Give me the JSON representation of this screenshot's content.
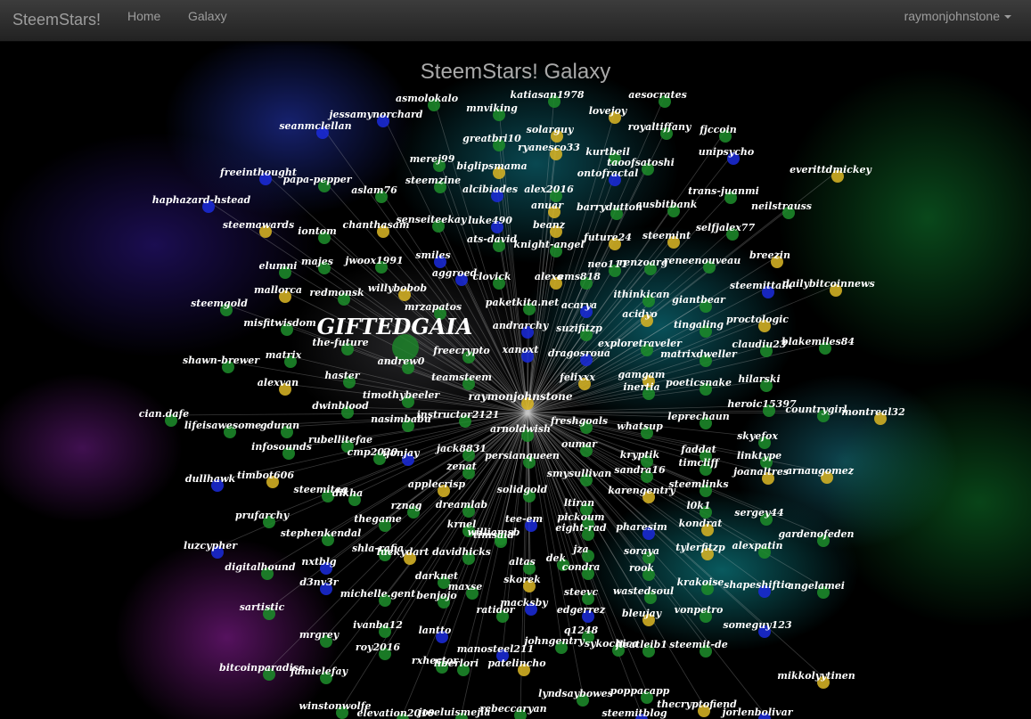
{
  "navbar": {
    "brand": "SteemStars!",
    "links": [
      "Home",
      "Galaxy"
    ],
    "user": "raymonjohnstone"
  },
  "galaxy": {
    "title": "SteemStars! Galaxy",
    "center_user": "raymonjohnstone",
    "featured_label": "GIFTEDGAIA",
    "colors": {
      "green": "#1d8a2a",
      "yellow": "#d6b324",
      "blue": "#1a2ad6",
      "link": "#c8c8c8",
      "label": "#ffffff"
    },
    "nodes": [
      {
        "name": "asmolokalo",
        "color": "green"
      },
      {
        "name": "katiasan1978",
        "color": "green"
      },
      {
        "name": "aesocrates",
        "color": "green"
      },
      {
        "name": "jessamynorchard",
        "color": "blue"
      },
      {
        "name": "mnviking",
        "color": "green"
      },
      {
        "name": "lovejoy",
        "color": "yellow"
      },
      {
        "name": "seanmclellan",
        "color": "blue"
      },
      {
        "name": "royaltiffany",
        "color": "green"
      },
      {
        "name": "fjccoin",
        "color": "green"
      },
      {
        "name": "greatbri10",
        "color": "green"
      },
      {
        "name": "solarguy",
        "color": "yellow"
      },
      {
        "name": "ryanesco33",
        "color": "yellow"
      },
      {
        "name": "kurtbeil",
        "color": "green"
      },
      {
        "name": "unipsycho",
        "color": "blue"
      },
      {
        "name": "merej99",
        "color": "green"
      },
      {
        "name": "taoofsatoshi",
        "color": "green"
      },
      {
        "name": "biglipsmama",
        "color": "yellow"
      },
      {
        "name": "freeinthought",
        "color": "blue"
      },
      {
        "name": "ontofractal",
        "color": "blue"
      },
      {
        "name": "everittdmickey",
        "color": "yellow"
      },
      {
        "name": "papa-pepper",
        "color": "green"
      },
      {
        "name": "steemzine",
        "color": "green"
      },
      {
        "name": "aslam76",
        "color": "green"
      },
      {
        "name": "alcibiades",
        "color": "blue"
      },
      {
        "name": "alex2016",
        "color": "green"
      },
      {
        "name": "trans-juanmi",
        "color": "green"
      },
      {
        "name": "haphazard-hstead",
        "color": "blue"
      },
      {
        "name": "anuar",
        "color": "yellow"
      },
      {
        "name": "barrydutton",
        "color": "green"
      },
      {
        "name": "ausbitbank",
        "color": "green"
      },
      {
        "name": "neilstrauss",
        "color": "green"
      },
      {
        "name": "senseiteekay",
        "color": "green"
      },
      {
        "name": "luke490",
        "color": "blue"
      },
      {
        "name": "steemawards",
        "color": "yellow"
      },
      {
        "name": "chanthasam",
        "color": "yellow"
      },
      {
        "name": "beanz",
        "color": "yellow"
      },
      {
        "name": "iontom",
        "color": "green"
      },
      {
        "name": "ats-david",
        "color": "green"
      },
      {
        "name": "selfjalex77",
        "color": "green"
      },
      {
        "name": "knight-angel",
        "color": "green"
      },
      {
        "name": "future24",
        "color": "yellow"
      },
      {
        "name": "steemint",
        "color": "yellow"
      },
      {
        "name": "smiles",
        "color": "blue"
      },
      {
        "name": "breezin",
        "color": "yellow"
      },
      {
        "name": "elumni",
        "color": "green"
      },
      {
        "name": "majes",
        "color": "green"
      },
      {
        "name": "jwoox1991",
        "color": "green"
      },
      {
        "name": "renzoarg",
        "color": "green"
      },
      {
        "name": "reneenouveau",
        "color": "green"
      },
      {
        "name": "neo111",
        "color": "green"
      },
      {
        "name": "aggroed",
        "color": "blue"
      },
      {
        "name": "clovick",
        "color": "green"
      },
      {
        "name": "alexo",
        "color": "yellow"
      },
      {
        "name": "ems818",
        "color": "green"
      },
      {
        "name": "mallorca",
        "color": "yellow"
      },
      {
        "name": "willybobob",
        "color": "yellow"
      },
      {
        "name": "steemittalk",
        "color": "blue"
      },
      {
        "name": "dailybitcoinnews",
        "color": "yellow"
      },
      {
        "name": "redmonsk",
        "color": "green"
      },
      {
        "name": "ithinkican",
        "color": "green"
      },
      {
        "name": "steemgold",
        "color": "green"
      },
      {
        "name": "paketkita.net",
        "color": "green"
      },
      {
        "name": "acarya",
        "color": "blue"
      },
      {
        "name": "giantbear",
        "color": "green"
      },
      {
        "name": "mrzapatos",
        "color": "green"
      },
      {
        "name": "acidyo",
        "color": "yellow"
      },
      {
        "name": "misfitwisdom",
        "color": "green"
      },
      {
        "name": "andrarchy",
        "color": "blue"
      },
      {
        "name": "suzifitzp",
        "color": "green"
      },
      {
        "name": "tingaling",
        "color": "green"
      },
      {
        "name": "proctologic",
        "color": "yellow"
      },
      {
        "name": "the-future",
        "color": "green"
      },
      {
        "name": "exploretraveler",
        "color": "green"
      },
      {
        "name": "claudiu23",
        "color": "green"
      },
      {
        "name": "blakemiles84",
        "color": "green"
      },
      {
        "name": "xanoxt",
        "color": "blue"
      },
      {
        "name": "freecrypto",
        "color": "green"
      },
      {
        "name": "matrix",
        "color": "green"
      },
      {
        "name": "dragosroua",
        "color": "blue"
      },
      {
        "name": "matrixdweller",
        "color": "green"
      },
      {
        "name": "andrew0",
        "color": "green"
      },
      {
        "name": "shawn-brewer",
        "color": "green"
      },
      {
        "name": "haster",
        "color": "green"
      },
      {
        "name": "teamsteem",
        "color": "green"
      },
      {
        "name": "felixxx",
        "color": "yellow"
      },
      {
        "name": "gamgam",
        "color": "yellow"
      },
      {
        "name": "hilarski",
        "color": "green"
      },
      {
        "name": "alexvan",
        "color": "yellow"
      },
      {
        "name": "inertia",
        "color": "green"
      },
      {
        "name": "poeticsnake",
        "color": "green"
      },
      {
        "name": "timothybeeler",
        "color": "green"
      },
      {
        "name": "raymonjohnstone",
        "color": "yellow"
      },
      {
        "name": "heroic15397",
        "color": "green"
      },
      {
        "name": "dwinblood",
        "color": "green"
      },
      {
        "name": "countrygirl",
        "color": "green"
      },
      {
        "name": "montreal32",
        "color": "yellow"
      },
      {
        "name": "leprechaun",
        "color": "green"
      },
      {
        "name": "cian.dafe",
        "color": "green"
      },
      {
        "name": "nasimbabu",
        "color": "green"
      },
      {
        "name": "instructor2121",
        "color": "green"
      },
      {
        "name": "freshgoals",
        "color": "green"
      },
      {
        "name": "lifeisawesome",
        "color": "green"
      },
      {
        "name": "gduran",
        "color": "green"
      },
      {
        "name": "arnoldwish",
        "color": "green"
      },
      {
        "name": "whatsup",
        "color": "green"
      },
      {
        "name": "skyefox",
        "color": "green"
      },
      {
        "name": "rubellitefae",
        "color": "green"
      },
      {
        "name": "oumar",
        "color": "green"
      },
      {
        "name": "infosounds",
        "color": "green"
      },
      {
        "name": "kryptik",
        "color": "green"
      },
      {
        "name": "faddat",
        "color": "green"
      },
      {
        "name": "cmp2020",
        "color": "green"
      },
      {
        "name": "ijonjay",
        "color": "blue"
      },
      {
        "name": "jack8831",
        "color": "green"
      },
      {
        "name": "persianqueen",
        "color": "green"
      },
      {
        "name": "linktype",
        "color": "green"
      },
      {
        "name": "timcliff",
        "color": "green"
      },
      {
        "name": "zenat",
        "color": "green"
      },
      {
        "name": "sandra16",
        "color": "green"
      },
      {
        "name": "arnaugomez",
        "color": "yellow"
      },
      {
        "name": "joanaltres",
        "color": "yellow"
      },
      {
        "name": "timbot606",
        "color": "yellow"
      },
      {
        "name": "dullhawk",
        "color": "blue"
      },
      {
        "name": "smysullivan",
        "color": "green"
      },
      {
        "name": "applecrisp",
        "color": "yellow"
      },
      {
        "name": "steemitag",
        "color": "green"
      },
      {
        "name": "dikha",
        "color": "green"
      },
      {
        "name": "steemlinks",
        "color": "green"
      },
      {
        "name": "solidgold",
        "color": "green"
      },
      {
        "name": "karengentry",
        "color": "yellow"
      },
      {
        "name": "rznag",
        "color": "green"
      },
      {
        "name": "dreamlab",
        "color": "green"
      },
      {
        "name": "ltiran",
        "color": "green"
      },
      {
        "name": "l0k1",
        "color": "green"
      },
      {
        "name": "prufarchy",
        "color": "green"
      },
      {
        "name": "sergey44",
        "color": "green"
      },
      {
        "name": "thegame",
        "color": "green"
      },
      {
        "name": "tee-em",
        "color": "blue"
      },
      {
        "name": "pickoum",
        "color": "green"
      },
      {
        "name": "kondrat",
        "color": "yellow"
      },
      {
        "name": "stephenkendal",
        "color": "green"
      },
      {
        "name": "krnel",
        "color": "green"
      },
      {
        "name": "williamsb",
        "color": "green"
      },
      {
        "name": "eight-rad",
        "color": "green"
      },
      {
        "name": "pharesim",
        "color": "blue"
      },
      {
        "name": "gardenofeden",
        "color": "green"
      },
      {
        "name": "timsaid",
        "color": "green"
      },
      {
        "name": "luzcypher",
        "color": "blue"
      },
      {
        "name": "shla-rafia",
        "color": "green"
      },
      {
        "name": "tylerfitzp",
        "color": "yellow"
      },
      {
        "name": "alexpatin",
        "color": "green"
      },
      {
        "name": "jza",
        "color": "green"
      },
      {
        "name": "soraya",
        "color": "green"
      },
      {
        "name": "nxtblg",
        "color": "blue"
      },
      {
        "name": "luckydart",
        "color": "yellow"
      },
      {
        "name": "davidhicks",
        "color": "green"
      },
      {
        "name": "altas",
        "color": "green"
      },
      {
        "name": "dek",
        "color": "green"
      },
      {
        "name": "condra",
        "color": "green"
      },
      {
        "name": "rook",
        "color": "green"
      },
      {
        "name": "digitalhound",
        "color": "green"
      },
      {
        "name": "krakoise",
        "color": "green"
      },
      {
        "name": "darknet",
        "color": "green"
      },
      {
        "name": "skorek",
        "color": "yellow"
      },
      {
        "name": "shapeshiftio",
        "color": "blue"
      },
      {
        "name": "angelamei",
        "color": "green"
      },
      {
        "name": "d3nv3r",
        "color": "blue"
      },
      {
        "name": "michelle.gent",
        "color": "green"
      },
      {
        "name": "benjojo",
        "color": "green"
      },
      {
        "name": "maxse",
        "color": "green"
      },
      {
        "name": "steevc",
        "color": "green"
      },
      {
        "name": "wastedsoul",
        "color": "green"
      },
      {
        "name": "sartistic",
        "color": "green"
      },
      {
        "name": "macksby",
        "color": "blue"
      },
      {
        "name": "edgerrez",
        "color": "blue"
      },
      {
        "name": "ratidor",
        "color": "green"
      },
      {
        "name": "bleujay",
        "color": "yellow"
      },
      {
        "name": "vonpetro",
        "color": "green"
      },
      {
        "name": "someguy123",
        "color": "blue"
      },
      {
        "name": "ivanba12",
        "color": "green"
      },
      {
        "name": "lantto",
        "color": "blue"
      },
      {
        "name": "q1248",
        "color": "green"
      },
      {
        "name": "mrgrey",
        "color": "green"
      },
      {
        "name": "manosteel211",
        "color": "blue"
      },
      {
        "name": "johngentry",
        "color": "green"
      },
      {
        "name": "sykochica",
        "color": "green"
      },
      {
        "name": "fleatleib1",
        "color": "green"
      },
      {
        "name": "steemit-de",
        "color": "green"
      },
      {
        "name": "roy2016",
        "color": "green"
      },
      {
        "name": "rxhector",
        "color": "green"
      },
      {
        "name": "liberlori",
        "color": "green"
      },
      {
        "name": "patelincho",
        "color": "yellow"
      },
      {
        "name": "bitcoinparadise",
        "color": "green"
      },
      {
        "name": "famielefay",
        "color": "green"
      },
      {
        "name": "mikkolyytinen",
        "color": "yellow"
      },
      {
        "name": "lyndsaybowes",
        "color": "green"
      },
      {
        "name": "poppacapp",
        "color": "green"
      },
      {
        "name": "winstonwolfe",
        "color": "green"
      },
      {
        "name": "thecryptofiend",
        "color": "yellow"
      },
      {
        "name": "jorlenbolivar",
        "color": "blue"
      },
      {
        "name": "elevation2010",
        "color": "green"
      },
      {
        "name": "joseluismejia",
        "color": "green"
      },
      {
        "name": "rebeccaryan",
        "color": "green"
      },
      {
        "name": "steemitblog",
        "color": "blue"
      }
    ]
  }
}
